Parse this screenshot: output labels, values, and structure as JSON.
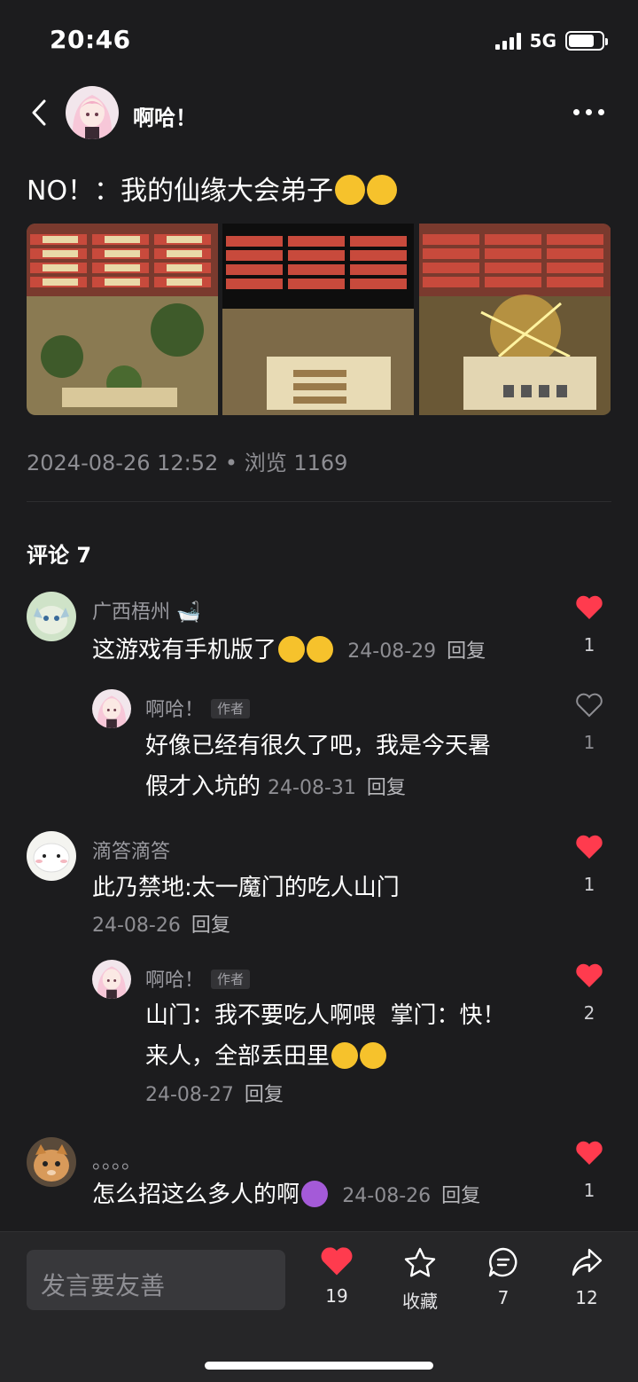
{
  "status": {
    "time": "20:46",
    "network": "5G"
  },
  "header": {
    "author": "啊哈！"
  },
  "post": {
    "title": "NO！：我的仙缘大会弟子",
    "images": [
      "screenshot-1",
      "screenshot-2",
      "screenshot-3"
    ],
    "date": "2024-08-26 12:52",
    "views": "浏览 1169"
  },
  "comments_title": "评论 7",
  "comments": [
    {
      "name": "广西梧州",
      "text": "这游戏有手机版了",
      "date": "24-08-29",
      "reply": "回复",
      "likes": "1",
      "liked": true
    },
    {
      "name": "啊哈！",
      "badge": "作者",
      "text_line1": "好像已经有很久了吧，我是今天暑",
      "text_line2": "假才入坑的",
      "date": "24-08-31",
      "reply": "回复",
      "likes": "1",
      "liked": false
    },
    {
      "name": "滴答滴答",
      "text": "此乃禁地:太一魔门的吃人山门",
      "date": "24-08-26",
      "reply": "回复",
      "likes": "1",
      "liked": true
    },
    {
      "name": "啊哈！",
      "badge": "作者",
      "text_line1": "山门：我不要吃人啊喂  掌门：快！",
      "text_line2": "来人，全部丢田里",
      "date": "24-08-27",
      "reply": "回复",
      "likes": "2",
      "liked": true
    },
    {
      "name": "。。。。",
      "text": "怎么招这么多人的啊",
      "date": "24-08-26",
      "reply": "回复",
      "likes": "1",
      "liked": true
    }
  ],
  "bottom": {
    "input_placeholder": "发言要友善",
    "likes": "19",
    "favorite": "收藏",
    "comments": "7",
    "shares": "12"
  },
  "colors": {
    "like_red": "#ff3b4e",
    "background": "#1c1c1e"
  }
}
